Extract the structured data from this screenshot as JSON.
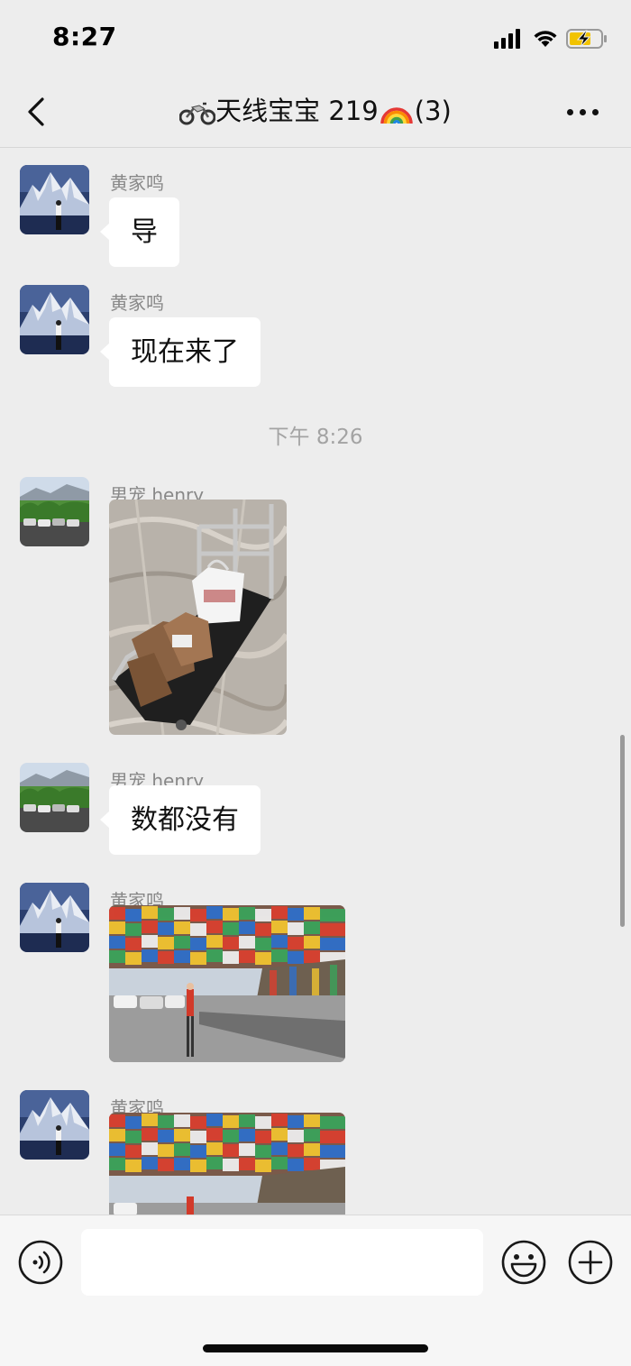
{
  "status_bar": {
    "time": "8:27"
  },
  "header": {
    "title": "天线宝宝 219",
    "member_count": "(3)",
    "title_prefix_icon": "motorcycle-emoji",
    "title_suffix_icon": "rainbow-emoji"
  },
  "messages": [
    {
      "sender": "黄家鸣",
      "type": "text",
      "text": "导",
      "avatar": "mountain-avatar"
    },
    {
      "sender": "黄家鸣",
      "type": "text",
      "text": "现在来了",
      "avatar": "mountain-avatar"
    },
    {
      "type": "time",
      "text": "下午 8:26"
    },
    {
      "sender": "男宠 henry",
      "type": "image",
      "image": "luggage-cart-photo",
      "avatar": "landscape-avatar"
    },
    {
      "sender": "男宠 henry",
      "type": "text",
      "text": "数都没有",
      "avatar": "landscape-avatar"
    },
    {
      "sender": "黄家鸣",
      "type": "image",
      "image": "prayer-flags-photo",
      "avatar": "mountain-avatar"
    },
    {
      "sender": "黄家鸣",
      "type": "image",
      "image": "prayer-flags-photo",
      "avatar": "mountain-avatar"
    }
  ],
  "input": {
    "value": "",
    "placeholder": ""
  },
  "colors": {
    "background": "#ededed",
    "bubble": "#ffffff",
    "sender_text": "#888888"
  }
}
